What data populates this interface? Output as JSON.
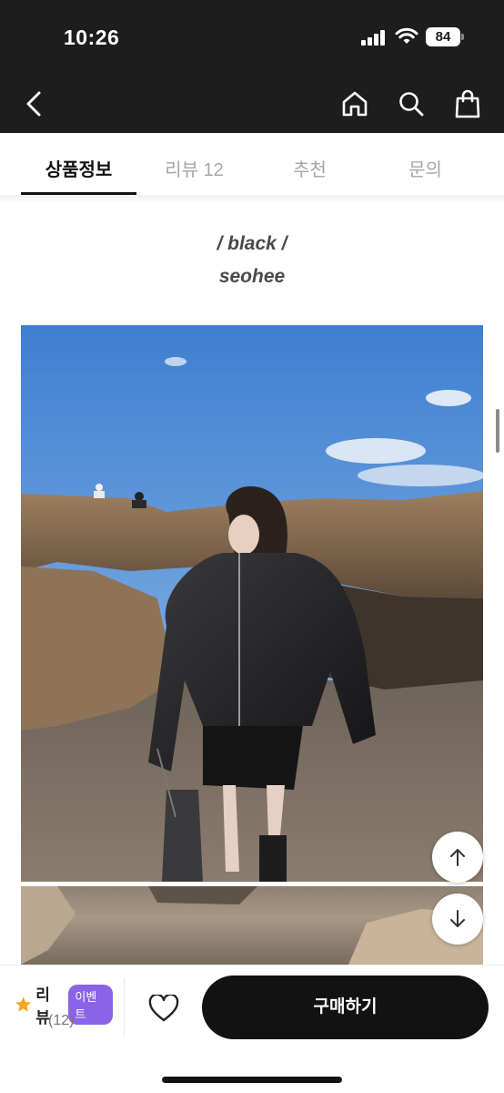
{
  "status_bar": {
    "time": "10:26",
    "battery": "84"
  },
  "header": {
    "back_icon": "chevron-left-icon",
    "home_icon": "home-icon",
    "search_icon": "search-icon",
    "bag_icon": "shopping-bag-icon"
  },
  "tabs": [
    {
      "label": "상품정보",
      "active": true
    },
    {
      "label": "리뷰 12",
      "active": false
    },
    {
      "label": "추천",
      "active": false
    },
    {
      "label": "문의",
      "active": false
    }
  ],
  "product": {
    "caption_line1": "/ black /",
    "caption_line2": "seohee"
  },
  "fab": {
    "up_icon": "arrow-up-icon",
    "down_icon": "arrow-down-icon"
  },
  "bottom_bar": {
    "review_label": "리뷰",
    "event_badge": "이벤트",
    "review_count": "(12)",
    "buy_label": "구매하기"
  },
  "colors": {
    "header_bg": "#1d1d1d",
    "badge": "#8a63e8",
    "star": "#f5a623",
    "buy_button": "#121212"
  }
}
